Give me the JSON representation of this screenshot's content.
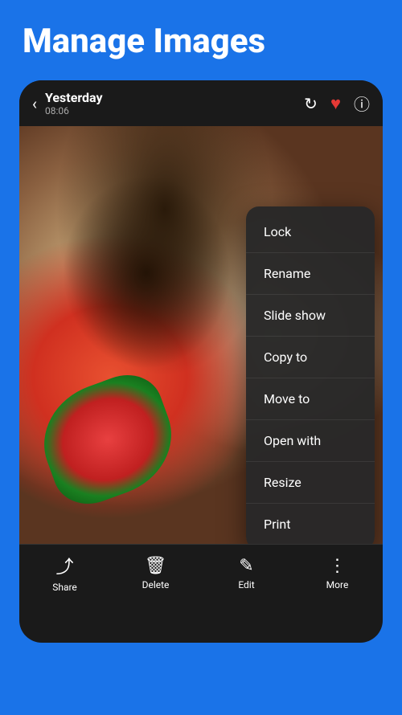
{
  "header": {
    "title": "Manage Images"
  },
  "topbar": {
    "title": "Yesterday",
    "subtitle": "08:06"
  },
  "context_menu": {
    "items": [
      {
        "label": "Lock"
      },
      {
        "label": "Rename"
      },
      {
        "label": "Slide show"
      },
      {
        "label": "Copy to"
      },
      {
        "label": "Move to"
      },
      {
        "label": "Open with"
      },
      {
        "label": "Resize"
      },
      {
        "label": "Print"
      }
    ]
  },
  "bottom_bar": {
    "items": [
      {
        "label": "Share",
        "icon": "share"
      },
      {
        "label": "Delete",
        "icon": "delete"
      },
      {
        "label": "Edit",
        "icon": "edit"
      },
      {
        "label": "More",
        "icon": "more"
      }
    ]
  },
  "icons": {
    "back": "‹",
    "rotate": "↻",
    "heart": "♥",
    "info": "ⓘ",
    "share": "⤴",
    "delete": "🗑",
    "edit": "✎",
    "more": "⋮"
  }
}
